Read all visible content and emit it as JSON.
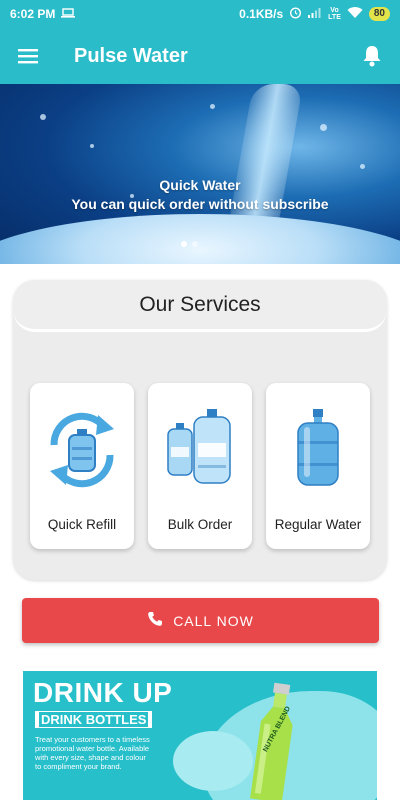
{
  "status": {
    "time": "6:02 PM",
    "speed": "0.1KB/s",
    "network": "Vo LTE",
    "network_top": "Vo",
    "network_bottom": "LTE",
    "battery": "80"
  },
  "app": {
    "title": "Pulse Water",
    "menu_icon": "hamburger-menu-icon",
    "bell_icon": "bell-icon"
  },
  "banner": {
    "title": "Quick Water",
    "subtitle": "You can quick order without subscribe",
    "slide_count": 2,
    "active_slide": 1
  },
  "services": {
    "title": "Our Services",
    "items": [
      {
        "label": "Quick Refill",
        "icon": "refill-cycle-icon"
      },
      {
        "label": "Bulk Order",
        "icon": "water-bottles-icon"
      },
      {
        "label": "Regular Water",
        "icon": "water-jug-icon"
      }
    ]
  },
  "call_button": {
    "label": "CALL NOW",
    "icon": "phone-icon",
    "color": "#e9484b"
  },
  "promo": {
    "title": "DRINK UP",
    "subtitle": "DRINK BOTTLES",
    "text": "Treat your customers to a timeless promotional water bottle. Available with every size, shape and colour to compliment your brand.",
    "bottle_brand": "NUTRA BLEND"
  },
  "colors": {
    "primary": "#2bbcc9",
    "accent_red": "#e9484b",
    "promo_bg": "#26bfca"
  }
}
